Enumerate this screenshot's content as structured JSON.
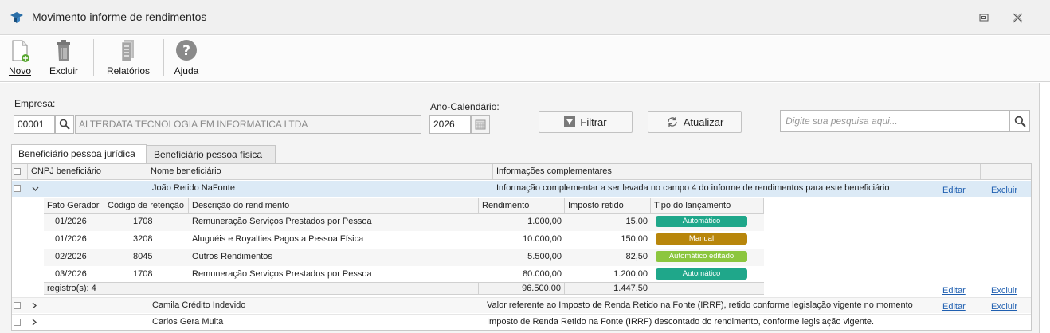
{
  "window": {
    "title": "Movimento informe de rendimentos"
  },
  "toolbar": {
    "novo": "Novo",
    "excluir": "Excluir",
    "relatorios": "Relatórios",
    "ajuda": "Ajuda"
  },
  "filters": {
    "empresa_label": "Empresa:",
    "empresa_code": "00001",
    "empresa_name": "ALTERDATA TECNOLOGIA EM INFORMATICA LTDA",
    "ano_label": "Ano-Calendário:",
    "ano_value": "2026",
    "filtrar": "Filtrar",
    "atualizar": "Atualizar",
    "search_placeholder": "Digite sua pesquisa aqui..."
  },
  "tabs": [
    {
      "label": "Beneficiário pessoa jurídica",
      "active": true
    },
    {
      "label": "Beneficiário pessoa física",
      "active": false
    }
  ],
  "grid": {
    "columns": {
      "cnpj": "CNPJ beneficiário",
      "nome": "Nome beneficiário",
      "info": "Informações complementares"
    },
    "rows": [
      {
        "nome": "João Retido NaFonte",
        "info": "Informação complementar a ser levada no campo 4 do informe de rendimentos para este beneficiário",
        "editar": "Editar",
        "excluir": "Excluir",
        "expanded": true
      },
      {
        "nome": "Camila Crédito Indevido",
        "info": "Valor referente ao Imposto de Renda Retido na Fonte (IRRF), retido conforme legislação vigente no momento",
        "editar": "Editar",
        "excluir": "Excluir"
      },
      {
        "nome": "Carlos Gera Multa",
        "info": "Imposto de Renda Retido na Fonte (IRRF) descontado do rendimento, conforme legislação vigente."
      }
    ],
    "footer_links": {
      "editar": "Editar",
      "excluir": "Excluir"
    }
  },
  "detail": {
    "columns": {
      "fato": "Fato Gerador",
      "codigo": "Código de retenção",
      "descricao": "Descrição do rendimento",
      "rendimento": "Rendimento",
      "imposto": "Imposto retido",
      "tipo": "Tipo do lançamento"
    },
    "rows": [
      {
        "fato": "01/2026",
        "codigo": "1708",
        "descricao": "Remuneração Serviços Prestados por Pessoa",
        "rendimento": "1.000,00",
        "imposto": "15,00",
        "tipo": "Automático",
        "tipo_color": "#1fa78a"
      },
      {
        "fato": "01/2026",
        "codigo": "3208",
        "descricao": "Aluguéis e Royalties Pagos a Pessoa Física",
        "rendimento": "10.000,00",
        "imposto": "150,00",
        "tipo": "Manual",
        "tipo_color": "#b8860b"
      },
      {
        "fato": "02/2026",
        "codigo": "8045",
        "descricao": "Outros Rendimentos",
        "rendimento": "5.500,00",
        "imposto": "82,50",
        "tipo": "Automático editado",
        "tipo_color": "#8cc63f"
      },
      {
        "fato": "03/2026",
        "codigo": "1708",
        "descricao": "Remuneração Serviços Prestados por Pessoa",
        "rendimento": "80.000,00",
        "imposto": "1.200,00",
        "tipo": "Automático",
        "tipo_color": "#1fa78a"
      }
    ],
    "footer": {
      "count": "registro(s): 4",
      "total_rendimento": "96.500,00",
      "total_imposto": "1.447,50"
    }
  }
}
